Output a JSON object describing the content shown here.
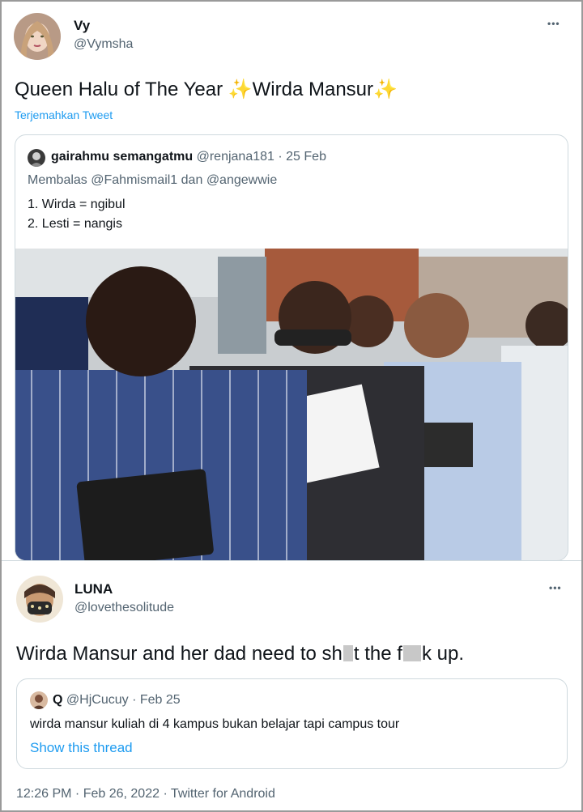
{
  "tweet1": {
    "author_name": "Vy",
    "author_handle": "@Vymsha",
    "more_label": "•••",
    "text": "Queen Halu of The Year",
    "text_suffix": "Wirda Mansur",
    "sparkle": "✨",
    "translate_label": "Terjemahkan Tweet",
    "quote": {
      "author_name": "gairahmu semangatmu",
      "author_handle": "@renjana181",
      "separator": "·",
      "date": "25 Feb",
      "reply_prefix": "Membalas",
      "reply_user1": "@Fahmismail1",
      "reply_and": "dan",
      "reply_user2": "@angewwie",
      "line1": "1. Wirda = ngibul",
      "line2": "2. Lesti = nangis"
    }
  },
  "tweet2": {
    "author_name": "LUNA",
    "author_handle": "@lovethesolitude",
    "more_label": "•••",
    "text_part1": "Wirda Mansur and her dad need to sh",
    "text_part2": "t the f",
    "text_part3": "k up.",
    "quote": {
      "author_name": "Q",
      "author_handle": "@HjCucuy",
      "separator": "·",
      "date": "Feb 25",
      "text": "wirda mansur kuliah di 4 kampus bukan belajar tapi campus tour",
      "show_thread": "Show this thread"
    },
    "footer": "12:26 PM · Feb 26, 2022 · Twitter for Android"
  },
  "colors": {
    "link": "#1d9bf0",
    "secondary": "#536471",
    "border": "#cfd9de"
  }
}
